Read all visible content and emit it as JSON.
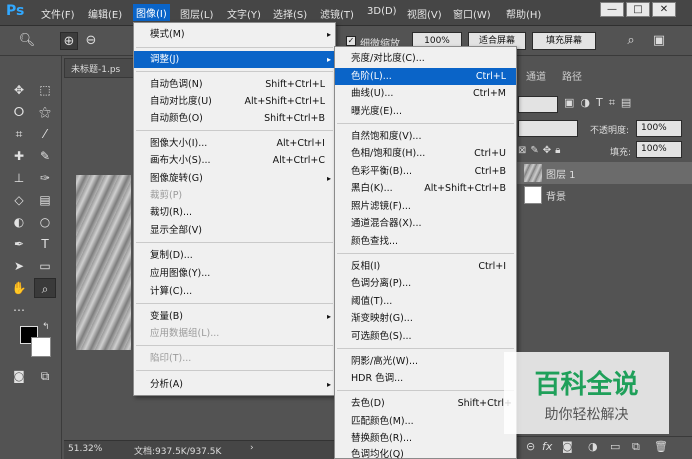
{
  "app": {
    "logo": "Ps"
  },
  "menubar": {
    "items": [
      "文件(F)",
      "编辑(E)",
      "图像(I)",
      "图层(L)",
      "文字(Y)",
      "选择(S)",
      "滤镜(T)",
      "3D(D)",
      "视图(V)",
      "窗口(W)",
      "帮助(H)"
    ],
    "window_buttons": [
      "—",
      "□",
      "✕"
    ]
  },
  "options_bar": {
    "checkbox_label": "细微缩放",
    "zoom_100": "100%",
    "fit_screen": "适合屏幕",
    "fill_screen": "填充屏幕"
  },
  "document": {
    "tab_title": "未标题-1.ps",
    "status_zoom": "51.32%",
    "status_doc": "文档:937.5K/937.5K",
    "status_arrow": "›"
  },
  "image_menu": {
    "items": [
      {
        "label": "模式(M)",
        "arrow": "▸"
      },
      {
        "label": "调整(J)",
        "arrow": "▸",
        "highlight": true
      },
      {
        "label": "自动色调(N)",
        "shortcut": "Shift+Ctrl+L"
      },
      {
        "label": "自动对比度(U)",
        "shortcut": "Alt+Shift+Ctrl+L"
      },
      {
        "label": "自动颜色(O)",
        "shortcut": "Shift+Ctrl+B"
      },
      {
        "label": "图像大小(I)...",
        "shortcut": "Alt+Ctrl+I"
      },
      {
        "label": "画布大小(S)...",
        "shortcut": "Alt+Ctrl+C"
      },
      {
        "label": "图像旋转(G)",
        "arrow": "▸"
      },
      {
        "label": "裁剪(P)",
        "disabled": true
      },
      {
        "label": "裁切(R)..."
      },
      {
        "label": "显示全部(V)"
      },
      {
        "label": "复制(D)..."
      },
      {
        "label": "应用图像(Y)..."
      },
      {
        "label": "计算(C)..."
      },
      {
        "label": "变量(B)",
        "arrow": "▸"
      },
      {
        "label": "应用数据组(L)...",
        "disabled": true
      },
      {
        "label": "陷印(T)...",
        "disabled": true
      },
      {
        "label": "分析(A)",
        "arrow": "▸"
      }
    ]
  },
  "adjust_menu": {
    "items": [
      {
        "label": "亮度/对比度(C)..."
      },
      {
        "label": "色阶(L)...",
        "shortcut": "Ctrl+L",
        "highlight": true
      },
      {
        "label": "曲线(U)...",
        "shortcut": "Ctrl+M"
      },
      {
        "label": "曝光度(E)..."
      },
      {
        "label": "自然饱和度(V)..."
      },
      {
        "label": "色相/饱和度(H)...",
        "shortcut": "Ctrl+U"
      },
      {
        "label": "色彩平衡(B)...",
        "shortcut": "Ctrl+B"
      },
      {
        "label": "黑白(K)...",
        "shortcut": "Alt+Shift+Ctrl+B"
      },
      {
        "label": "照片滤镜(F)..."
      },
      {
        "label": "通道混合器(X)..."
      },
      {
        "label": "颜色查找..."
      },
      {
        "label": "反相(I)",
        "shortcut": "Ctrl+I"
      },
      {
        "label": "色调分离(P)..."
      },
      {
        "label": "阈值(T)..."
      },
      {
        "label": "渐变映射(G)..."
      },
      {
        "label": "可选颜色(S)..."
      },
      {
        "label": "阴影/高光(W)..."
      },
      {
        "label": "HDR 色调..."
      },
      {
        "label": "去色(D)",
        "shortcut": "Shift+Ctrl+"
      },
      {
        "label": "匹配颜色(M)..."
      },
      {
        "label": "替换颜色(R)..."
      },
      {
        "label": "色调均化(Q)"
      }
    ]
  },
  "right_panel": {
    "tabs": [
      "通道",
      "路径"
    ],
    "opacity_label": "不透明度:",
    "opacity_value": "100%",
    "fill_label": "填充:",
    "fill_value": "100%",
    "layers": [
      {
        "name": "图层 1"
      },
      {
        "name": "背景"
      }
    ],
    "bottom_fx": "fx"
  },
  "watermark": {
    "title": "百科全说",
    "subtitle": "助你轻松解决"
  },
  "colors": {
    "accent": "#0a64c8",
    "panel": "#535353",
    "menu_bg": "#f0f0f0",
    "watermark_green": "#1fa05a"
  }
}
